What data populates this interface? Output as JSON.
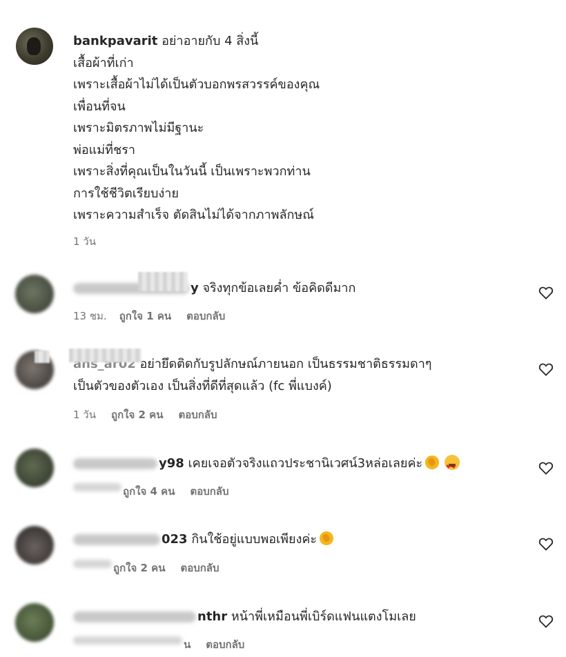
{
  "main_comment": {
    "username": "bankpavarit",
    "first_line": "อย่าอายกับ 4 สิ่งนี้",
    "lines": [
      "เสื้อผ้าที่เก่า",
      "เพราะเสื้อผ้าไม่ได้เป็นตัวบอกพรสวรรค์ของคุณ",
      "เพื่อนที่จน",
      "เพราะมิตรภาพไม่มีฐานะ",
      "พ่อแม่ที่ชรา",
      "เพราะสิ่งที่คุณเป็นในวันนี้ เป็นเพราะพวกท่าน",
      "การใช้ชีวิตเรียบง่าย",
      "เพราะความสำเร็จ ตัดสินไม่ได้จากภาพลักษณ์"
    ],
    "time": "1 วัน"
  },
  "replies": [
    {
      "username_visible": "y",
      "text": "จริงทุกข้อเลยค่ำ ข้อคิดดีมาก",
      "time": "13 ชม.",
      "likes": "ถูกใจ 1 คน",
      "reply_label": "ตอบกลับ"
    },
    {
      "username_visible": "ans_ar02",
      "text": "อย่ายึดติดกับรูปลักษณ์ภายนอก เป็นธรรมชาติธรรมดาๆ",
      "text_line2": "เป็นตัวของตัวเอง เป็นสิ่งที่ดีที่สุดแล้ว (fc พี่แบงค์)",
      "time": "1 วัน",
      "likes": "ถูกใจ 2 คน",
      "reply_label": "ตอบกลับ"
    },
    {
      "username_visible": "y98",
      "text": "เคยเจอตัวจริงแถวประชานิเวศน์3หล่อเลยค่ะ",
      "likes": "ถูกใจ 4 คน",
      "reply_label": "ตอบกลับ",
      "emojis": [
        "clapping-hands-emoji",
        "heart-eyes-emoji"
      ]
    },
    {
      "username_visible": "023",
      "text": "กินใช้อยู่แบบพอเพียงค่ะ",
      "likes": "ถูกใจ 2 คน",
      "reply_label": "ตอบกลับ",
      "emojis": [
        "clapping-hands-emoji"
      ]
    },
    {
      "username_visible": "nthr",
      "text": "หน้าพี่เหมือนพี่เบิร์ดแฟนแตงโมเลย",
      "likes_partial": "น",
      "reply_label": "ตอบกลับ"
    }
  ],
  "icons": {
    "like": "heart-outline-icon"
  }
}
